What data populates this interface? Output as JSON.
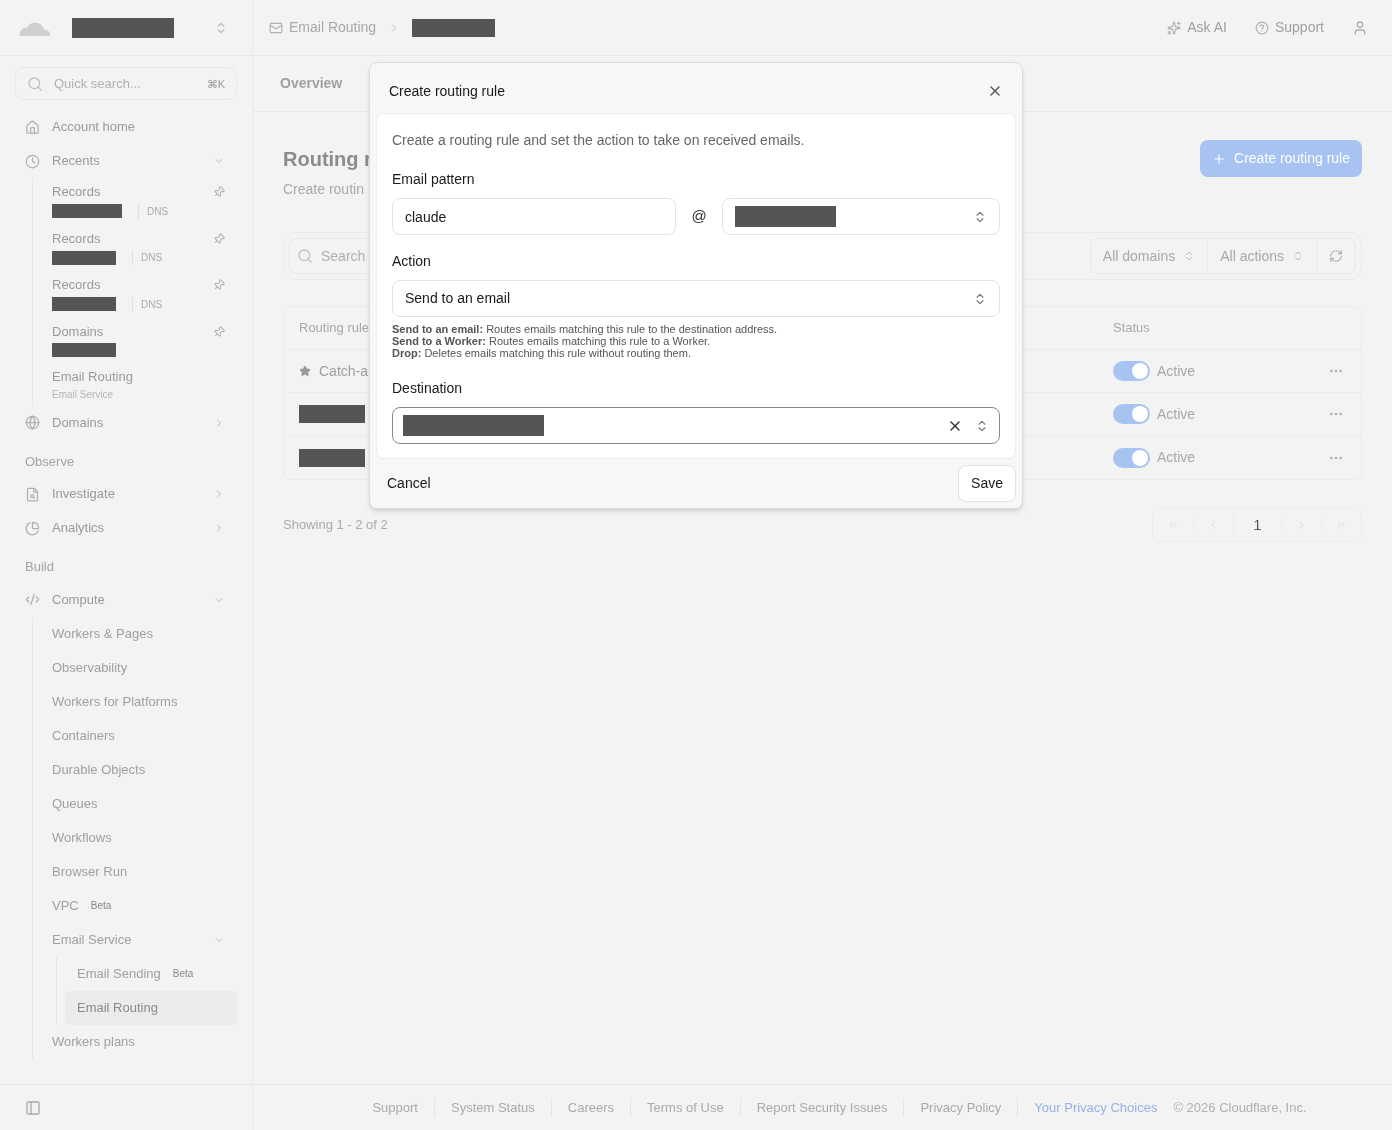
{
  "header": {
    "breadcrumb": [
      {
        "label": "Email Routing"
      }
    ],
    "actions": [
      {
        "kind": "ai",
        "label": "Ask AI"
      },
      {
        "kind": "help",
        "label": "Support"
      }
    ]
  },
  "sidebar": {
    "search": {
      "placeholder": "Quick search...",
      "shortcut": "⌘K"
    },
    "entries": [
      {
        "kind": "item",
        "label": "Account home"
      },
      {
        "kind": "item",
        "label": "Recents",
        "expanded": true,
        "recents": [
          {
            "title": "Records",
            "tag": "DNS",
            "pinned": true
          },
          {
            "title": "Records",
            "tag": "DNS",
            "pinned": true
          },
          {
            "title": "Records",
            "tag": "DNS",
            "pinned": true
          },
          {
            "title": "Domains",
            "pinned": true
          },
          {
            "title": "Email Routing",
            "subtitle": "Email Service",
            "pinned": false
          }
        ]
      },
      {
        "kind": "item",
        "label": "Domains",
        "expanded": false
      },
      {
        "kind": "section",
        "label": "Observe"
      },
      {
        "kind": "item",
        "label": "Investigate",
        "expanded": false
      },
      {
        "kind": "item",
        "label": "Analytics",
        "expanded": false
      },
      {
        "kind": "section",
        "label": "Build"
      },
      {
        "kind": "item",
        "label": "Compute",
        "expanded": true,
        "children": [
          {
            "label": "Workers & Pages",
            "selected": false
          },
          {
            "label": "Observability",
            "selected": false
          },
          {
            "label": "Workers for Platforms",
            "selected": false
          },
          {
            "label": "Containers",
            "selected": false
          },
          {
            "label": "Durable Objects",
            "selected": false
          },
          {
            "label": "Queues",
            "selected": false
          },
          {
            "label": "Workflows",
            "selected": false
          },
          {
            "label": "Browser Run",
            "selected": false
          },
          {
            "label": "VPC",
            "badge": "Beta",
            "selected": false
          },
          {
            "label": "Email Service",
            "expanded": true,
            "selected": false,
            "children": [
              {
                "label": "Email Sending",
                "badge": "Beta",
                "selected": false
              },
              {
                "label": "Email Routing",
                "selected": true
              }
            ]
          },
          {
            "label": "Workers plans",
            "selected": false
          }
        ]
      }
    ]
  },
  "tabs": [
    {
      "label": "Overview",
      "selected": false
    }
  ],
  "page": {
    "title": "Routing r",
    "subtitle": "Create routin",
    "create_button": "Create routing rule"
  },
  "filters": {
    "search_placeholder": "Search",
    "selects": [
      "All domains",
      "All actions"
    ]
  },
  "table": {
    "columns": [
      "Routing rule",
      "Status"
    ],
    "rows": [
      {
        "kind": "catch_all",
        "name": "Catch-a",
        "on": true,
        "status": "Active"
      },
      {
        "kind": "redacted",
        "on": true,
        "status": "Active"
      },
      {
        "kind": "redacted",
        "on": true,
        "status": "Active"
      }
    ]
  },
  "pagination": {
    "summary": "Showing 1 - 2 of 2",
    "pages": [
      {
        "label": "1",
        "selected": true
      }
    ]
  },
  "dialog": {
    "title": "Create routing rule",
    "description": "Create a routing rule and set the action to take on received emails.",
    "pattern_label": "Email pattern",
    "pattern_value": "claude",
    "at": "@",
    "action_label": "Action",
    "action_value": "Send to an email",
    "help": [
      "**Send to an email:** Routes emails matching this rule to the destination address.",
      "**Send to a Worker:** Routes emails matching this rule to a Worker.",
      "**Drop:** Deletes emails matching this rule without routing them."
    ],
    "destination_label": "Destination",
    "cancel": "Cancel",
    "save": "Save"
  },
  "footer": {
    "links": [
      {
        "label": "Support",
        "kind": "plain"
      },
      {
        "label": "System Status",
        "kind": "plain"
      },
      {
        "label": "Careers",
        "kind": "plain"
      },
      {
        "label": "Terms of Use",
        "kind": "plain"
      },
      {
        "label": "Report Security Issues",
        "kind": "plain"
      },
      {
        "label": "Privacy Policy",
        "kind": "plain"
      },
      {
        "label": "Your Privacy Choices",
        "kind": "accent"
      }
    ],
    "copyright": "© 2026 Cloudflare, Inc."
  }
}
